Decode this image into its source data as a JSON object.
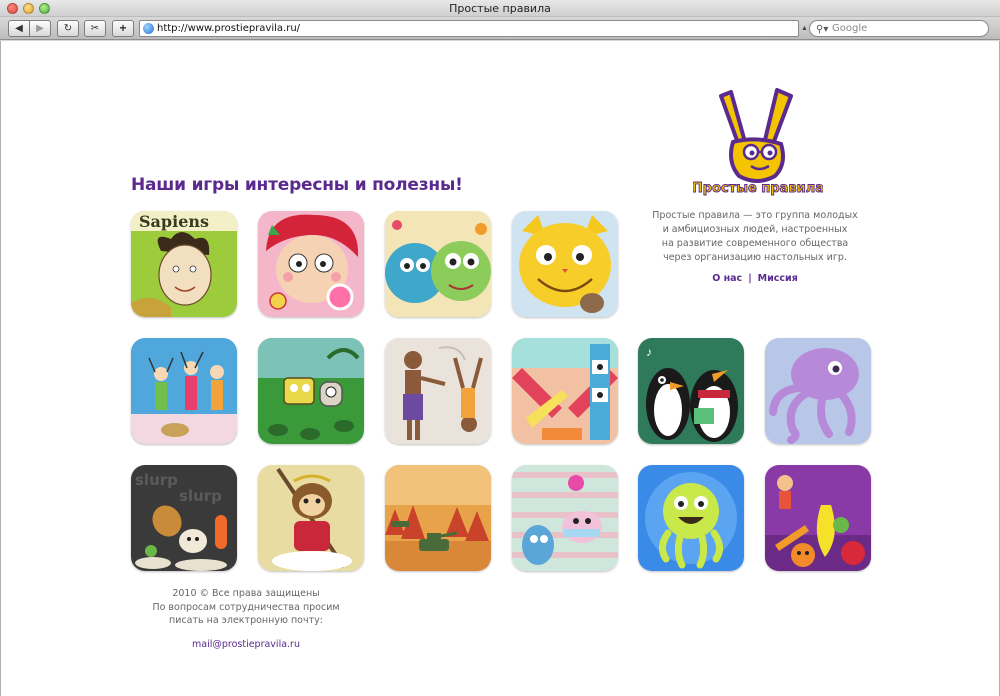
{
  "window": {
    "title": "Простые правила"
  },
  "browser": {
    "url": "http://www.prostiepravila.ru/",
    "search_placeholder": "Google"
  },
  "page": {
    "headline": "Наши игры интересны и полезны!",
    "logo_text": "Простые правила",
    "about": {
      "lines": [
        "Простые правила — это группа молодых",
        "и амбициозных людей, настроенных",
        "на развитие современного общества",
        "через организацию настольных игр."
      ],
      "link_about": "О нас",
      "separator": "|",
      "link_mission": "Миссия"
    },
    "games": {
      "sapiens_label": "Sapiens",
      "slurp_label": "slurp"
    },
    "footer": {
      "lines": [
        "2010 © Все права защищены",
        "По вопросам сотрудничества просим",
        "писать на электронную почту:"
      ],
      "email": "mail@prostiepravila.ru"
    },
    "colors": {
      "brand_purple": "#5a2a8f",
      "brand_yellow": "#f5c400"
    }
  }
}
